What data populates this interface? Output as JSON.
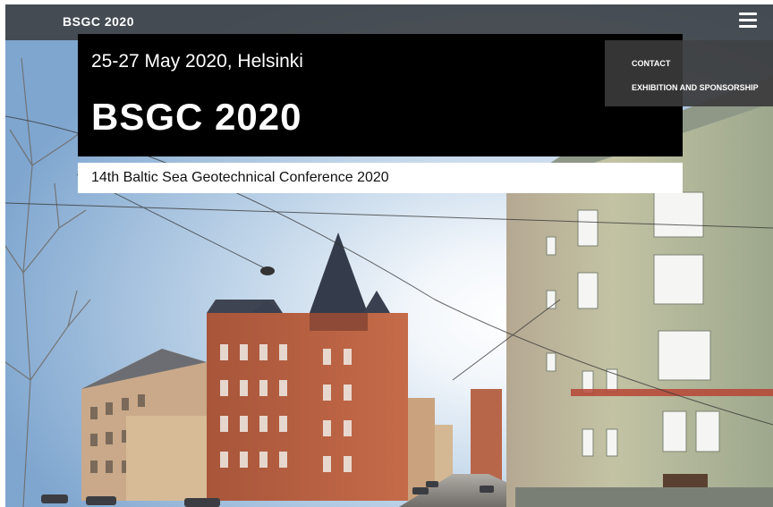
{
  "header": {
    "site_title": "BSGC 2020",
    "menu_icon": "hamburger-menu-icon"
  },
  "menu": {
    "items": [
      {
        "label": "CONTACT"
      },
      {
        "label": "EXHIBITION AND SPONSORSHIP"
      }
    ]
  },
  "hero": {
    "date_location": "25-27 May 2020, Helsinki",
    "name": "BSGC 2020",
    "subtitle": "14th Baltic Sea Geotechnical Conference 2020",
    "background": "photo of a Helsinki street with old buildings and sunlight"
  },
  "colors": {
    "topbar": "#373737",
    "hero_box": "#000000",
    "subtitle_box": "#ffffff",
    "text_light": "#ffffff",
    "text_dark": "#111111"
  }
}
